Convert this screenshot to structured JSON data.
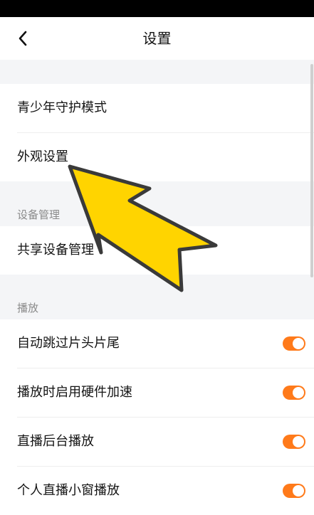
{
  "header": {
    "title": "设置",
    "back_icon": "chevron-left-icon"
  },
  "groups": [
    {
      "label": "",
      "items": [
        {
          "label": "青少年守护模式"
        },
        {
          "label": "外观设置"
        }
      ]
    },
    {
      "label": "设备管理",
      "items": [
        {
          "label": "共享设备管理"
        }
      ]
    },
    {
      "label": "播放",
      "items": [
        {
          "label": "自动跳过片头片尾",
          "toggle": true
        },
        {
          "label": "播放时启用硬件加速",
          "toggle": true
        },
        {
          "label": "直播后台播放",
          "toggle": true
        },
        {
          "label": "个人直播小窗播放",
          "toggle": true
        }
      ]
    }
  ],
  "colors": {
    "accent": "#ff7a1a",
    "annotation_arrow_fill": "#ffd400",
    "annotation_arrow_stroke": "#3a3a3a",
    "section_background": "#f4f5f7"
  },
  "annotation": {
    "icon": "pointer-arrow-annotation",
    "target": "外观设置"
  }
}
